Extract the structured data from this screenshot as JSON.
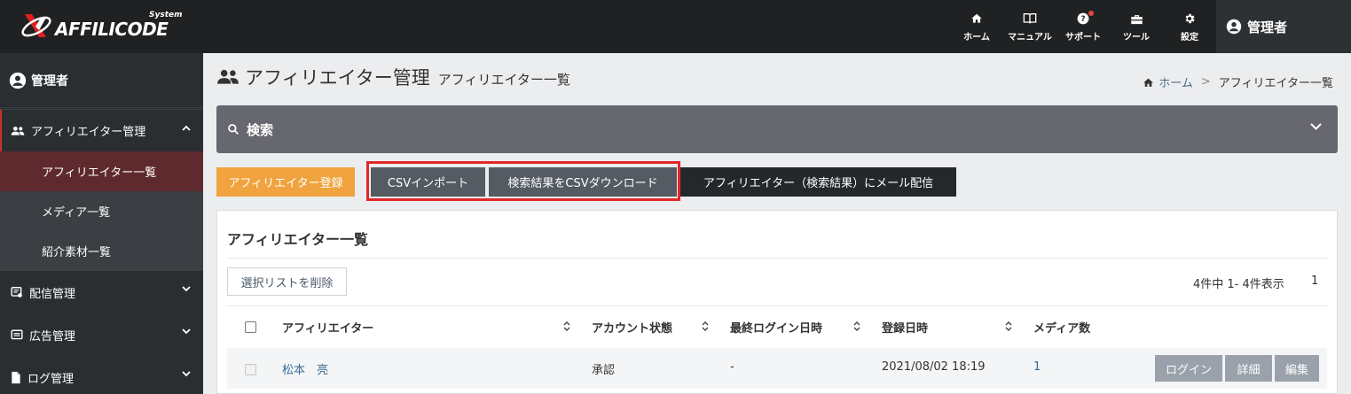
{
  "header": {
    "logo_text": "AFFILICODE",
    "logo_sup": "System",
    "nav": [
      {
        "label": "ホーム",
        "icon": "home-icon"
      },
      {
        "label": "マニュアル",
        "icon": "book-icon"
      },
      {
        "label": "サポート",
        "icon": "help-icon"
      },
      {
        "label": "ツール",
        "icon": "toolbox-icon"
      },
      {
        "label": "設定",
        "icon": "gear-icon"
      }
    ],
    "user_label": "管理者"
  },
  "sidebar": {
    "user_label": "管理者",
    "groups": [
      {
        "label": "アフィリエイター管理",
        "icon": "people-icon",
        "expanded": true,
        "items": [
          {
            "label": "アフィリエイター一覧",
            "current": true
          },
          {
            "label": "メディア一覧"
          },
          {
            "label": "紹介素材一覧"
          }
        ]
      },
      {
        "label": "配信管理",
        "icon": "delivery-icon"
      },
      {
        "label": "広告管理",
        "icon": "ad-icon"
      },
      {
        "label": "ログ管理",
        "icon": "log-icon"
      }
    ]
  },
  "page": {
    "title": "アフィリエイター管理",
    "subtitle": "アフィリエイター一覧",
    "breadcrumb": {
      "home": "ホーム",
      "sep": ">",
      "current": "アフィリエイター一覧"
    }
  },
  "search": {
    "label": "検索"
  },
  "actions": {
    "register": "アフィリエイター登録",
    "csv_import": "CSVインポート",
    "csv_download": "検索結果をCSVダウンロード",
    "mail": "アフィリエイター（検索結果）にメール配信"
  },
  "list": {
    "title": "アフィリエイター一覧",
    "delete_button": "選択リストを削除",
    "count_text": "4件中 1- 4件表示",
    "page": "1",
    "columns": [
      "アフィリエイター",
      "アカウント状態",
      "最終ログイン日時",
      "登録日時",
      "メディア数"
    ],
    "rows": [
      {
        "name": "松本　亮",
        "status": "承認",
        "last_login": "-",
        "registered": "2021/08/02 18:19",
        "media_count": "1",
        "buttons": {
          "login": "ログイン",
          "detail": "詳細",
          "edit": "編集"
        }
      }
    ]
  },
  "colors": {
    "header_bg": "#1f2123",
    "sidebar_bg": "#2b2e31",
    "accent_orange": "#f0a33e",
    "highlight_red": "#e3262a",
    "search_bar": "#66676f",
    "link_blue": "#3a6c96"
  }
}
